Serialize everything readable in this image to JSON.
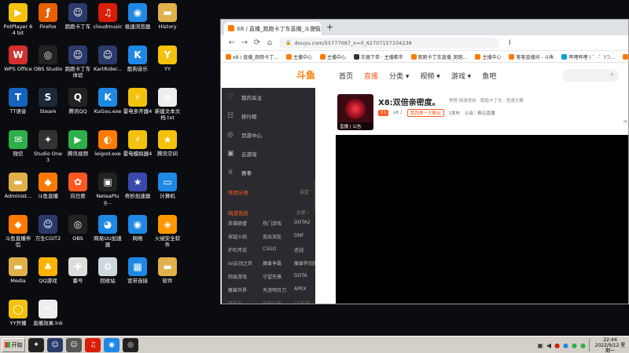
{
  "desktop": {
    "icons": [
      {
        "label": "PotPlayer 64 bit",
        "glyph": "▶",
        "color": "#f4c20d"
      },
      {
        "label": "Firefox",
        "glyph": "ƒ",
        "color": "#e66000"
      },
      {
        "label": "跑跑卡丁车",
        "glyph": "☺",
        "color": "#2a3a6a"
      },
      {
        "label": "cloudmusic",
        "glyph": "♫",
        "color": "#d81e06"
      },
      {
        "label": "极速浏览器",
        "glyph": "◉",
        "color": "#1e88e5"
      },
      {
        "label": "History",
        "glyph": "▬",
        "color": "#e0b04a"
      },
      {
        "label": "WPS Office",
        "glyph": "W",
        "color": "#d32f2f"
      },
      {
        "label": "OBS Studio",
        "glyph": "◎",
        "color": "#222222"
      },
      {
        "label": "跑跑卡丁车 体验",
        "glyph": "☺",
        "color": "#2a3a6a"
      },
      {
        "label": "KartRider...",
        "glyph": "☺",
        "color": "#2a3a6a"
      },
      {
        "label": "酷狗音乐",
        "glyph": "K",
        "color": "#1e88e5"
      },
      {
        "label": "YY",
        "glyph": "Y",
        "color": "#f4c20d"
      },
      {
        "label": "TT语音",
        "glyph": "T",
        "color": "#1565c0"
      },
      {
        "label": "Steam",
        "glyph": "S",
        "color": "#1b2838"
      },
      {
        "label": "腾讯QQ",
        "glyph": "Q",
        "color": "#222222"
      },
      {
        "label": "KuGou.exe",
        "glyph": "K",
        "color": "#1e88e5"
      },
      {
        "label": "雷电多开器4",
        "glyph": "⚡",
        "color": "#f4c20d"
      },
      {
        "label": "新建文本文档.txt",
        "glyph": "≡",
        "color": "#eeeeee"
      },
      {
        "label": "微信",
        "glyph": "✉",
        "color": "#2eaf4a"
      },
      {
        "label": "Studio One 3",
        "glyph": "✦",
        "color": "#333333"
      },
      {
        "label": "腾讯视频",
        "glyph": "▶",
        "color": "#2eaf4a"
      },
      {
        "label": "leigod.exe",
        "glyph": "◐",
        "color": "#ff7a00"
      },
      {
        "label": "雷电模拟器4",
        "glyph": "⚡",
        "color": "#f4c20d"
      },
      {
        "label": "腾讯空间",
        "glyph": "★",
        "color": "#f4c20d"
      },
      {
        "label": "Administ...",
        "glyph": "▬",
        "color": "#e0b04a"
      },
      {
        "label": "斗鱼直播",
        "glyph": "◆",
        "color": "#ff7a00"
      },
      {
        "label": "向日葵",
        "glyph": "✿",
        "color": "#ff5722"
      },
      {
        "label": "NeteaPlug...",
        "glyph": "▣",
        "color": "#222222"
      },
      {
        "label": "奇妙加速器",
        "glyph": "★",
        "color": "#3949ab"
      },
      {
        "label": "计算机",
        "glyph": "▭",
        "color": "#1e88e5"
      },
      {
        "label": "斗鱼直播伴侣",
        "glyph": "◆",
        "color": "#ff7a00"
      },
      {
        "label": "万生CGIT2",
        "glyph": "☺",
        "color": "#2a3a6a"
      },
      {
        "label": "OBS",
        "glyph": "◎",
        "color": "#222222"
      },
      {
        "label": "网易UU加速器",
        "glyph": "◕",
        "color": "#1e88e5"
      },
      {
        "label": "网络",
        "glyph": "◉",
        "color": "#1e88e5"
      },
      {
        "label": "火绒安全软件",
        "glyph": "◈",
        "color": "#ff9800"
      },
      {
        "label": "Media",
        "glyph": "▬",
        "color": "#e0b04a"
      },
      {
        "label": "QQ游戏",
        "glyph": "♣",
        "color": "#ffb300"
      },
      {
        "label": "番号",
        "glyph": "✚",
        "color": "#dddddd"
      },
      {
        "label": "回收站",
        "glyph": "♻",
        "color": "#cfd8dc"
      },
      {
        "label": "宽带连接",
        "glyph": "▦",
        "color": "#1e88e5"
      },
      {
        "label": "软件",
        "glyph": "▬",
        "color": "#e0b04a"
      },
      {
        "label": "YY开播",
        "glyph": "◯",
        "color": "#f4c20d"
      },
      {
        "label": "直播效果.lnk",
        "glyph": "⌐",
        "color": "#eeeeee"
      }
    ]
  },
  "browser": {
    "tab_title": "X8 / 直播_跑跑卡丁车直播_斗鱼直播",
    "tab_close": "×",
    "new_tab": "+",
    "nav": {
      "back": "←",
      "forward": "→",
      "reload": "⟳",
      "home": "⌂"
    },
    "url": "douyu.com/55777097_x=0_62707157104238",
    "bookmarks": [
      {
        "label": "x8 / 直播_跑跑卡丁...",
        "color": "#ff7a00"
      },
      {
        "label": "主播中心",
        "color": "#ff7a00"
      },
      {
        "label": "主播中心",
        "color": "#ff7a00"
      },
      {
        "label": "灰器下单 · 主播都市",
        "color": "#333333"
      },
      {
        "label": "跑跑卡丁车直播_跑跑...",
        "color": "#ff7a00"
      },
      {
        "label": "主播中心",
        "color": "#ff7a00"
      },
      {
        "label": "客客直播间 - 斗鱼",
        "color": "#ff7a00"
      },
      {
        "label": "哔哩哔哩 ( ゜-゜)つ...",
        "color": "#00a1d6"
      },
      {
        "label": "舞蹈直播_舞蹈视频",
        "color": "#ff7a00"
      }
    ],
    "site": {
      "logo": "斗鱼",
      "menu": [
        "首页",
        "直播",
        "分类 ▾",
        "视频 ▾",
        "游戏 ▾",
        "鱼吧"
      ],
      "active_menu": "直播"
    },
    "sidebar": {
      "items": [
        {
          "label": "我的关注",
          "icon": "heart-icon",
          "glyph": "♡"
        },
        {
          "label": "排行榜",
          "icon": "ranking-icon",
          "glyph": "☷"
        },
        {
          "label": "页游中心",
          "icon": "game-center-icon",
          "glyph": "◎"
        },
        {
          "label": "云游戏",
          "icon": "gamepad-icon",
          "glyph": "▣"
        },
        {
          "label": "赛事",
          "icon": "trophy-icon",
          "glyph": "♕"
        }
      ],
      "common_section": "常用分类",
      "common_more": "自定",
      "esports_section": "网游竞技",
      "esports_more": "全部 ›",
      "games": [
        "英雄联盟",
        "热门游戏",
        "DOTA2",
        "穿越火线",
        "逃出深处",
        "DNF",
        "炉石传说",
        "CSGO",
        "逆战",
        "lol云顶之弈",
        "魔兽争霸",
        "魔兽怀旧服",
        "网易游戏",
        "守望先锋",
        "DOTA",
        "魔兽世界",
        "天涯明月刀",
        "APEX",
        "冒险岛",
        "最终幻想",
        "CF手游"
      ],
      "collapse": "‹"
    },
    "room": {
      "title": "X8:双倍亲密度。",
      "category_meta": "李程   网游竞技 · 跑跑卡丁车 · 竞速大赛",
      "avatar_caption": "直播 | 公告",
      "level_badge": "11",
      "streamer_tag": "x8 ♪",
      "rank_tag": "跑跑第一大舞台",
      "fans": "1发布",
      "notice": "公会：枫吕直播",
      "share": "⇱"
    }
  },
  "taskbar": {
    "start": "开始",
    "apps": [
      {
        "name": "app-studio-one",
        "glyph": "✦",
        "color": "#222222"
      },
      {
        "name": "app-kart",
        "glyph": "☺",
        "color": "#2a3a6a"
      },
      {
        "name": "app-kart2",
        "glyph": "☺",
        "color": "#555555"
      },
      {
        "name": "app-cloudmusic",
        "glyph": "♫",
        "color": "#d81e06"
      },
      {
        "name": "app-chrome",
        "glyph": "◉",
        "color": "#1e88e5"
      },
      {
        "name": "app-obs",
        "glyph": "◎",
        "color": "#222222"
      }
    ],
    "time": "22:44",
    "date": "2022/9/12 星期一"
  }
}
